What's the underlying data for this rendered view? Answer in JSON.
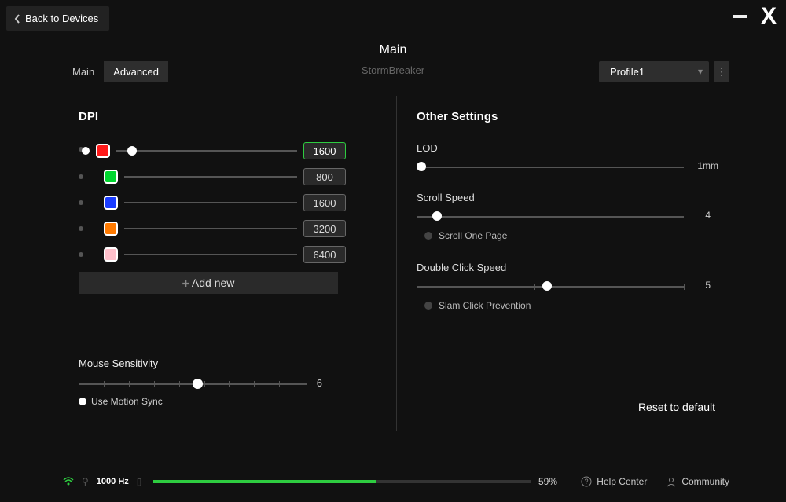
{
  "back_label": "Back to Devices",
  "header": {
    "title": "Main"
  },
  "device_name": "StormBreaker",
  "tabs": {
    "main": "Main",
    "advanced": "Advanced",
    "active": "advanced"
  },
  "profile": {
    "selected": "Profile1"
  },
  "dpi": {
    "title": "DPI",
    "rows": [
      {
        "color": "#ff1a1a",
        "value": "1600",
        "selected": true,
        "handle_pct": 6
      },
      {
        "color": "#00d62f",
        "value": "800",
        "selected": false,
        "handle_pct": 0
      },
      {
        "color": "#1a3cff",
        "value": "1600",
        "selected": false,
        "handle_pct": 0
      },
      {
        "color": "#ff7a00",
        "value": "3200",
        "selected": false,
        "handle_pct": 0
      },
      {
        "color": "#ffc0cb",
        "value": "6400",
        "selected": false,
        "handle_pct": 0
      }
    ],
    "add_new": "Add new"
  },
  "sensitivity": {
    "label": "Mouse Sensitivity",
    "value": "6",
    "handle_pct": 50,
    "motion_sync": "Use Motion Sync"
  },
  "other": {
    "title": "Other Settings",
    "lod": {
      "label": "LOD",
      "value": "1mm",
      "handle_pct": 0
    },
    "scroll": {
      "label": "Scroll Speed",
      "value": "4",
      "handle_pct": 6,
      "one_page": "Scroll One Page"
    },
    "dclick": {
      "label": "Double Click Speed",
      "value": "5",
      "handle_pct": 47,
      "slam": "Slam Click Prevention"
    },
    "reset": "Reset to default"
  },
  "footer": {
    "rate": "1000 Hz",
    "battery_pct": "59%",
    "battery_fill": 59,
    "help": "Help Center",
    "community": "Community"
  }
}
